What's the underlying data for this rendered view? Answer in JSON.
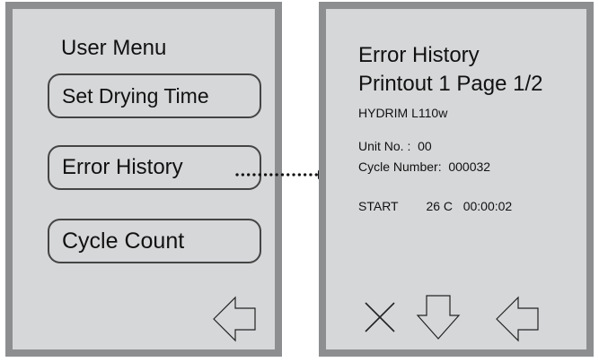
{
  "left_screen": {
    "title": "User Menu",
    "buttons": [
      {
        "label": "Set Drying Time"
      },
      {
        "label": "Error History"
      },
      {
        "label": "Cycle Count"
      }
    ],
    "back_icon": "back-arrow-icon"
  },
  "right_screen": {
    "title_line1": "Error History",
    "title_line2": "Printout 1 Page 1/2",
    "model": "HYDRIM L110w",
    "unit_line": "Unit No. :  00",
    "cycle_line": "Cycle Number:  000032",
    "start_row": "START        26 C   00:00:02",
    "icons": [
      "close-icon",
      "down-arrow-icon",
      "back-arrow-icon"
    ]
  },
  "colors": {
    "panel_background": "#d6d7d9",
    "panel_border": "#8d8e90",
    "text": "#111111"
  }
}
